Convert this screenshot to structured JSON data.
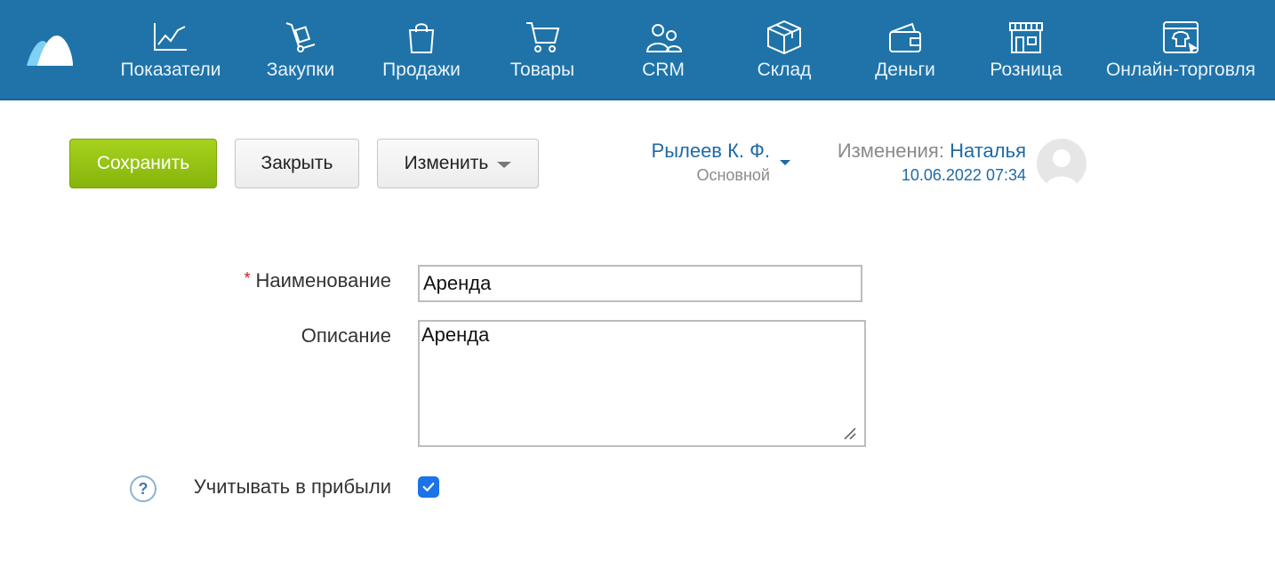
{
  "nav": {
    "items": [
      {
        "label": "Показатели",
        "icon": "chart-line-icon"
      },
      {
        "label": "Закупки",
        "icon": "hand-truck-icon"
      },
      {
        "label": "Продажи",
        "icon": "shopping-bag-icon"
      },
      {
        "label": "Товары",
        "icon": "cart-icon"
      },
      {
        "label": "CRM",
        "icon": "people-icon"
      },
      {
        "label": "Склад",
        "icon": "box-icon"
      },
      {
        "label": "Деньги",
        "icon": "wallet-icon"
      },
      {
        "label": "Розница",
        "icon": "store-icon"
      },
      {
        "label": "Онлайн-торговля",
        "icon": "online-shop-icon"
      }
    ]
  },
  "toolbar": {
    "save_label": "Сохранить",
    "close_label": "Закрыть",
    "edit_label": "Изменить"
  },
  "owner": {
    "name": "Рылеев К. Ф.",
    "group": "Основной"
  },
  "changes": {
    "label": "Изменения:",
    "user": "Наталья",
    "date": "10.06.2022 07:34"
  },
  "form": {
    "name_label": "Наименование",
    "name_value": "Аренда",
    "description_label": "Описание",
    "description_value": "Аренда",
    "profit_label": "Учитывать в прибыли",
    "profit_checked": true,
    "help_symbol": "?"
  },
  "colors": {
    "topbar": "#1f73a8",
    "save_button": "#98c414",
    "link": "#1f6aa5",
    "checkbox": "#1a73e8"
  }
}
